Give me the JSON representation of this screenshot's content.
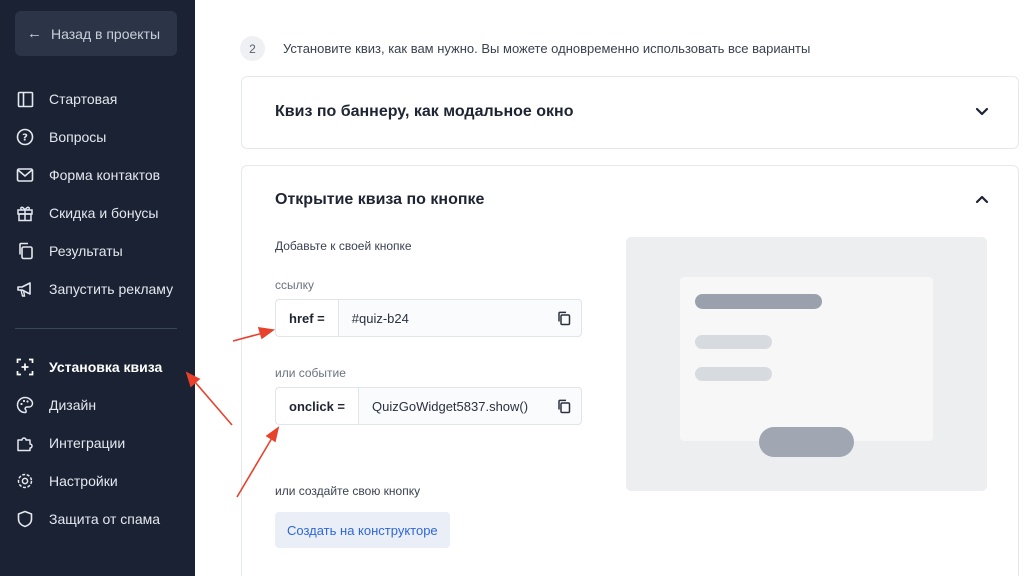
{
  "sidebar": {
    "back_label": "Назад в проекты",
    "items": [
      {
        "label": "Стартовая",
        "icon": "layout-icon"
      },
      {
        "label": "Вопросы",
        "icon": "question-icon"
      },
      {
        "label": "Форма контактов",
        "icon": "mail-icon"
      },
      {
        "label": "Скидка и бонусы",
        "icon": "gift-icon"
      },
      {
        "label": "Результаты",
        "icon": "copy-icon"
      },
      {
        "label": "Запустить рекламу",
        "icon": "megaphone-icon"
      },
      {
        "label": "Установка квиза",
        "icon": "embed-icon",
        "active": true
      },
      {
        "label": "Дизайн",
        "icon": "palette-icon"
      },
      {
        "label": "Интеграции",
        "icon": "puzzle-icon"
      },
      {
        "label": "Настройки",
        "icon": "gear-icon"
      },
      {
        "label": "Защита от спама",
        "icon": "shield-icon"
      }
    ]
  },
  "main": {
    "step_number": "2",
    "step_text": "Установите квиз, как вам нужно. Вы можете одновременно использовать все варианты",
    "section_banner": {
      "title": "Квиз по баннеру, как модальное окно",
      "expanded": false
    },
    "section_button": {
      "title": "Открытие квиза по кнопке",
      "expanded": true,
      "intro": "Добавьте к своей кнопке",
      "link_label": "ссылку",
      "href_key": "href =",
      "href_value": "#quiz-b24",
      "event_label": "или событие",
      "onclick_key": "onclick =",
      "onclick_value": "QuizGoWidget5837.show()",
      "create_label": "или создайте свою кнопку",
      "create_button": "Создать на конструкторе"
    }
  },
  "colors": {
    "sidebar_bg": "#1a2233",
    "accent_blue": "#2f67d8",
    "annotation_red": "#e8412c"
  }
}
